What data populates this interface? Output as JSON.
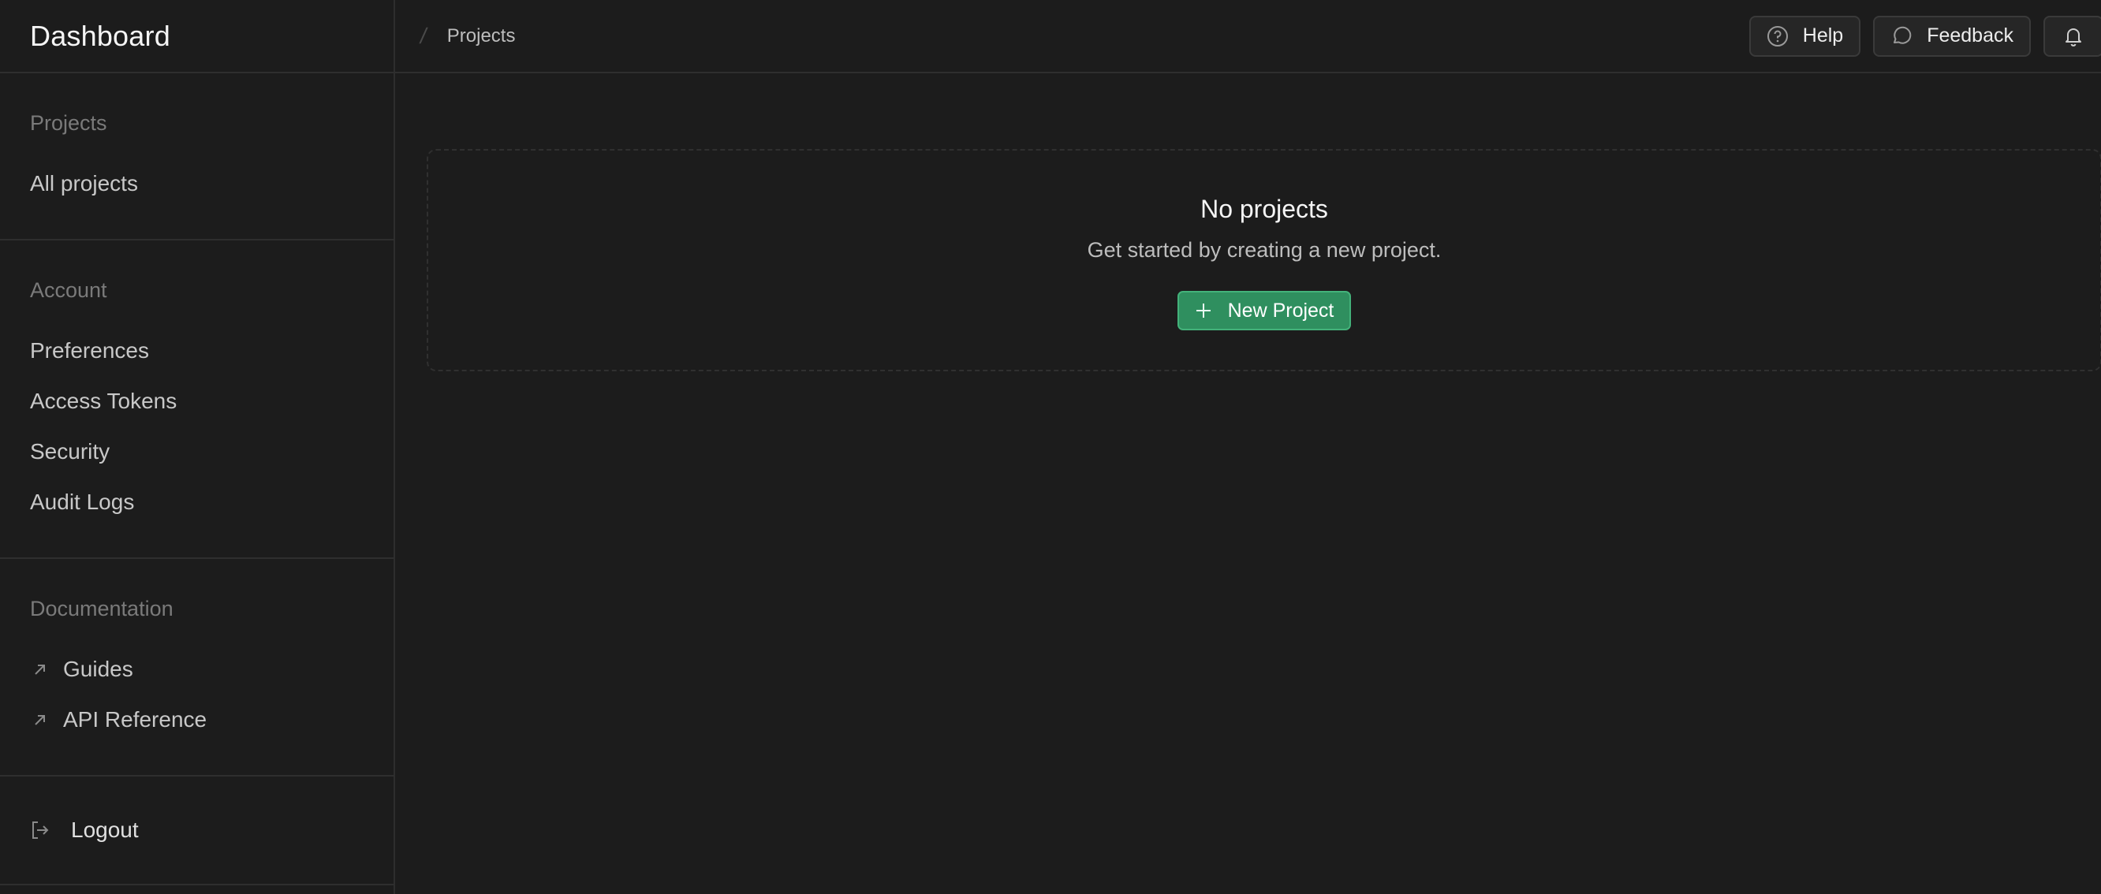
{
  "sidebar": {
    "title": "Dashboard",
    "sections": [
      {
        "title": "Projects",
        "items": [
          {
            "label": "All projects"
          }
        ]
      },
      {
        "title": "Account",
        "items": [
          {
            "label": "Preferences"
          },
          {
            "label": "Access Tokens"
          },
          {
            "label": "Security"
          },
          {
            "label": "Audit Logs"
          }
        ]
      },
      {
        "title": "Documentation",
        "items": [
          {
            "label": "Guides",
            "icon": "external-link-icon"
          },
          {
            "label": "API Reference",
            "icon": "external-link-icon"
          }
        ]
      }
    ],
    "logout": {
      "label": "Logout",
      "icon": "logout-icon"
    }
  },
  "topbar": {
    "breadcrumb": "Projects",
    "help_label": "Help",
    "feedback_label": "Feedback",
    "notifications_icon": "bell-icon"
  },
  "empty_state": {
    "title": "No projects",
    "subtitle": "Get started by creating a new project.",
    "button_label": "New Project"
  },
  "colors": {
    "background": "#1c1c1c",
    "border": "#2e2e2e",
    "accent_green": "#2f8f5f",
    "accent_green_border": "#43b27a"
  }
}
